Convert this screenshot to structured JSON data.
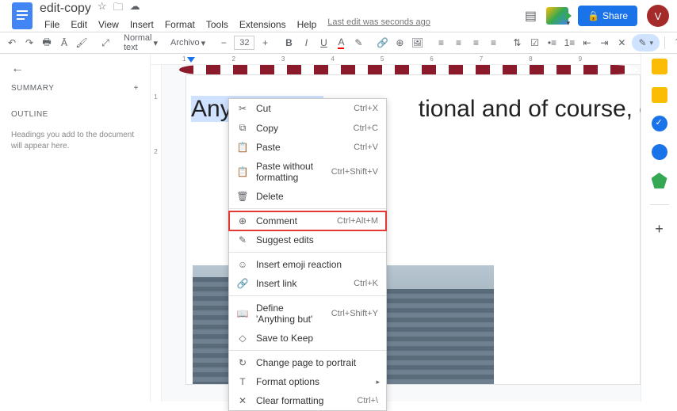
{
  "title": "edit-copy",
  "menus": [
    "File",
    "Edit",
    "View",
    "Insert",
    "Format",
    "Tools",
    "Extensions",
    "Help"
  ],
  "last_edit": "Last edit was seconds ago",
  "share_label": "Share",
  "avatar_letter": "V",
  "toolbar": {
    "style": "Normal text",
    "font": "Archivo",
    "size": "32"
  },
  "sidebar": {
    "summary": "SUMMARY",
    "outline": "OUTLINE",
    "hint": "Headings you add to the document will appear here."
  },
  "document": {
    "selected_text": "Anything but",
    "rest_text": "tional and  of course, emiss"
  },
  "context_menu": [
    {
      "icon": "✂",
      "label": "Cut",
      "shortcut": "Ctrl+X"
    },
    {
      "icon": "⧉",
      "label": "Copy",
      "shortcut": "Ctrl+C"
    },
    {
      "icon": "📋",
      "label": "Paste",
      "shortcut": "Ctrl+V"
    },
    {
      "icon": "📋",
      "label": "Paste without formatting",
      "shortcut": "Ctrl+Shift+V"
    },
    {
      "icon": "🗑",
      "label": "Delete",
      "shortcut": ""
    },
    {
      "sep": true
    },
    {
      "icon": "⊕",
      "label": "Comment",
      "shortcut": "Ctrl+Alt+M",
      "highlight": true
    },
    {
      "icon": "✎",
      "label": "Suggest edits",
      "shortcut": ""
    },
    {
      "sep": true
    },
    {
      "icon": "☺",
      "label": "Insert emoji reaction",
      "shortcut": ""
    },
    {
      "icon": "🔗",
      "label": "Insert link",
      "shortcut": "Ctrl+K"
    },
    {
      "sep": true
    },
    {
      "icon": "📖",
      "label": "Define 'Anything but'",
      "shortcut": "Ctrl+Shift+Y"
    },
    {
      "icon": "◇",
      "label": "Save to Keep",
      "shortcut": ""
    },
    {
      "sep": true
    },
    {
      "icon": "↻",
      "label": "Change page to portrait",
      "shortcut": ""
    },
    {
      "icon": "T",
      "label": "Format options",
      "shortcut": "",
      "sub": true
    },
    {
      "icon": "✕",
      "label": "Clear formatting",
      "shortcut": "Ctrl+\\"
    }
  ],
  "ruler_numbers": [
    "1",
    "2",
    "3",
    "4",
    "5",
    "6",
    "7",
    "8",
    "9"
  ],
  "ruler_v": [
    "1",
    "2"
  ]
}
